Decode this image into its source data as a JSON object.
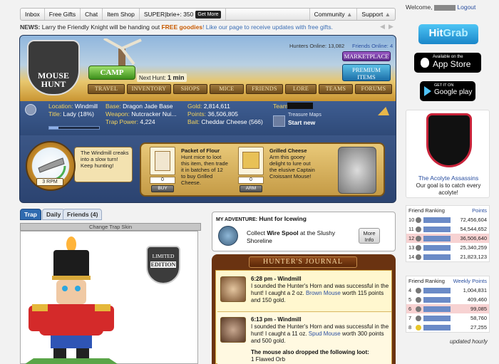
{
  "topnav": {
    "items": [
      "Inbox",
      "Free Gifts",
      "Chat",
      "Item Shop"
    ],
    "super_brie": "SUPER|brie+: 350",
    "get_more": "Get More",
    "community": "Community",
    "support": "Support"
  },
  "news": {
    "label": "NEWS:",
    "text_prefix": "Larry the Friendly Knight will be handing out ",
    "highlight": "FREE goodies",
    "text_suffix": "! Like our page to receive updates with free gifts."
  },
  "hud": {
    "logo_line1": "MOUSE",
    "logo_line2": "HUNT",
    "camp": "CAMP",
    "next_hunt_label": "Next Hunt:",
    "next_hunt_value": "1 min",
    "hunters_online": "Hunters Online: 13,082",
    "friends_online": "Friends Online: 4",
    "marketplace": "MARKETPLACE",
    "premium_line1": "PREMIUM",
    "premium_line2": "ITEMS",
    "nav": [
      "TRAVEL",
      "INVENTORY",
      "SHOPS",
      "MICE",
      "FRIENDS",
      "LORE",
      "TEAMS",
      "FORUMS"
    ]
  },
  "stats": {
    "location_label": "Location:",
    "location": "Windmill",
    "title_label": "Title:",
    "title": "Lady (18%)",
    "title_progress": 0.18,
    "trap_power_label": "Trap Power:",
    "trap_power": "4,224",
    "base_label": "Base:",
    "base": "Dragon Jade Base",
    "weapon_label": "Weapon:",
    "weapon": "Nutcracker Nui...",
    "gold_label": "Gold:",
    "gold": "2,814,611",
    "points_label": "Points:",
    "points": "36,506,805",
    "bait_label": "Bait:",
    "bait": "Cheddar Cheese (566)",
    "team_label": "Team:",
    "treasure_maps": "Treasure Maps",
    "start_new": "Start new"
  },
  "horn": {
    "rpm": "3 RPM",
    "message": "The Windmill creaks into a slow turn! Keep hunting!"
  },
  "items": {
    "flour": {
      "count": "0",
      "button": "BUY",
      "name": "Packet of Flour",
      "desc": "Hunt mice to loot this item, then trade it in batches of 12 to buy Grilled Cheese."
    },
    "cheese": {
      "count": "0",
      "button": "ARM",
      "name": "Grilled Cheese",
      "desc": "Arm this gooey delight to lure out the elusive Captain Croissant Mouse!"
    }
  },
  "trap": {
    "tabs": [
      "Trap",
      "Daily",
      "Friends (4)"
    ],
    "change_skin": "Change Trap Skin",
    "limited_line1": "LIMITED",
    "limited_line2": "EDITION"
  },
  "adventure": {
    "label": "MY ADVENTURE:",
    "title": "Hunt for Icewing",
    "text_prefix": "Collect ",
    "item": "Wire Spool",
    "text_suffix": " at the Slushy Shoreline",
    "more_line1": "More",
    "more_line2": "Info"
  },
  "journal": {
    "title": "HUNTER'S JOURNAL",
    "entries": [
      {
        "time": "6:28 pm - Windmill",
        "text_prefix": "I sounded the Hunter's Horn and was successful in the hunt! I caught a 2 oz. ",
        "mouse": "Brown Mouse",
        "text_suffix": " worth 115 points and 150 gold."
      },
      {
        "time": "6:13 pm - Windmill",
        "text_prefix": "I sounded the Hunter's Horn and was successful in the hunt! I caught a 11 oz. ",
        "mouse": "Spud Mouse",
        "text_suffix": " worth 300 points and 500 gold."
      }
    ],
    "loot_line": "The mouse also dropped the following loot:",
    "loot_item": "1 Flawed Orb"
  },
  "sidebar": {
    "welcome": "Welcome,",
    "logout": "Logout",
    "hitgrab_hit": "Hit",
    "hitgrab_grab": "Grab",
    "appstore_small": "Available on the",
    "appstore_big": "App Store",
    "google_small": "GET IT ON",
    "google_big": "Google play",
    "team_name": "The Acolyte Assassins",
    "team_goal": "Our goal is to catch every acolyte!",
    "updated": "updated hourly"
  },
  "friend_ranking_points": {
    "header": "Friend Ranking",
    "metric": "Points",
    "rows": [
      {
        "rank": "10",
        "value": "72,456,604"
      },
      {
        "rank": "11",
        "value": "54,544,652"
      },
      {
        "rank": "12",
        "value": "36,506,640"
      },
      {
        "rank": "13",
        "value": "25,340,259"
      },
      {
        "rank": "14",
        "value": "21,823,123"
      }
    ]
  },
  "friend_ranking_weekly": {
    "header": "Friend Ranking",
    "metric": "Weekly Points",
    "rows": [
      {
        "rank": "4",
        "value": "1,004,831"
      },
      {
        "rank": "5",
        "value": "409,460"
      },
      {
        "rank": "6",
        "value": "99,085"
      },
      {
        "rank": "7",
        "value": "58,760"
      },
      {
        "rank": "8",
        "value": "27,255"
      }
    ]
  },
  "colors": {
    "hud_blue": "#35507e",
    "gold_label": "#f3d35d",
    "link_blue": "#2a4fa0",
    "journal_brown": "#6a3311"
  }
}
